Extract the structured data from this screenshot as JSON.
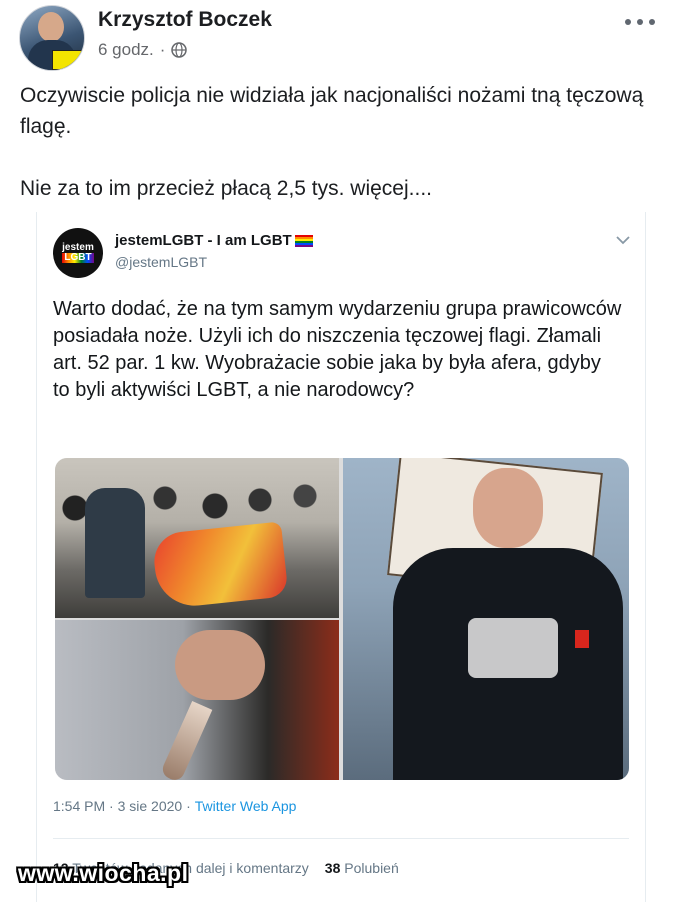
{
  "post": {
    "author": "Krzysztof Boczek",
    "time": "6 godz.",
    "separator": "·",
    "icons": {
      "audience": "globe-icon",
      "menu": "more-options-icon"
    },
    "text_line1": "Oczywiscie policja nie widziała jak nacjonaliści nożami tną tęczową flagę.",
    "text_line2": "Nie za to im przecież płacą 2,5 tys. więcej...."
  },
  "tweet": {
    "avatar_text_top": "jestem",
    "avatar_text_bottom": "LGBT",
    "display_name": "jestemLGBT - I am LGBT",
    "handle": "@jestemLGBT",
    "text": "Warto dodać, że na tym samym wydarzeniu grupa prawicowców posiadała noże. Użyli ich do niszczenia tęczowej flagi. Złamali art. 52 par. 1 kw. Wyobrażacie sobie jaka by była afera, gdyby to byli aktywiści LGBT, a nie narodowcy?",
    "timestamp": "1:54 PM · 3 sie 2020 ·",
    "source": "Twitter Web App",
    "retweets_count": "12",
    "retweets_label": "Tweetów podanych dalej i komentarzy",
    "likes_count": "38",
    "likes_label": "Polubień",
    "colors": {
      "link": "#1b95e0",
      "muted": "#657786"
    }
  },
  "watermark": "www.wiocha.pl"
}
